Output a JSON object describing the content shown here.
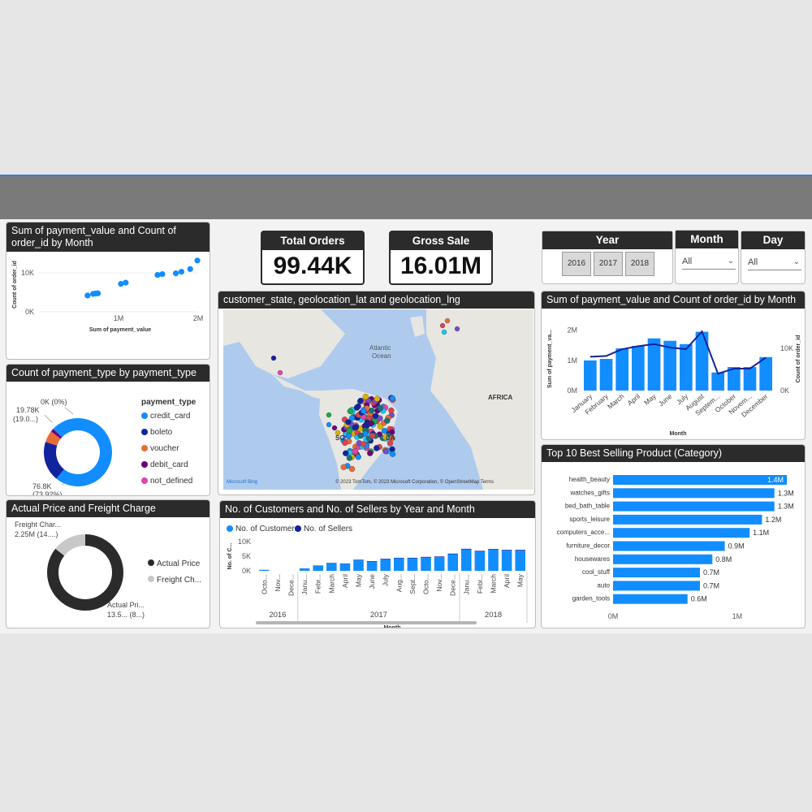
{
  "kpis": [
    {
      "label": "Total Orders",
      "value": "99.44K"
    },
    {
      "label": "Gross Sale",
      "value": "16.01M"
    }
  ],
  "slicers": {
    "year": {
      "title": "Year",
      "options": [
        "2016",
        "2017",
        "2018"
      ]
    },
    "month": {
      "title": "Month",
      "value": "All"
    },
    "day": {
      "title": "Day",
      "value": "All"
    }
  },
  "scatter": {
    "title": "Sum of payment_value and Count of order_id by Month",
    "xlabel": "Sum of payment_value",
    "ylabel": "Count of order_id",
    "xticks": [
      "1M",
      "2M"
    ],
    "yticks": [
      "0K",
      "10K"
    ]
  },
  "donut_payment": {
    "title": "Count of payment_type by payment_type",
    "legend_title": "payment_type",
    "labels": {
      "big": "76.8K",
      "big_pct": "(73.92%)",
      "mid": "19.78K",
      "mid_pct": "(19.0...)",
      "zero": "0K (0%)"
    }
  },
  "donut_price": {
    "title": "Actual Price and Freight Charge",
    "labels": {
      "freight": "Freight Char...",
      "freight_val": "2.25M (14....)",
      "actual": "Actual Pri...",
      "actual_val": "13.5... (8...)"
    }
  },
  "map": {
    "title": "customer_state, geolocation_lat and geolocation_lng",
    "labels": {
      "ocean": "Atlantic",
      "ocean2": "Ocean",
      "africa": "AFRICA",
      "so": "SO",
      "ca": "CA",
      "logo": "Microsoft Bing",
      "attribution": "© 2023 TomTom, © 2023 Microsoft Corporation, © OpenStreetMap  Terms"
    }
  },
  "combo": {
    "title": "Sum of payment_value and Count of order_id by Month",
    "xlabel": "Month",
    "ylabel_left": "Sum of payment_va...",
    "ylabel_right": "Count of order_id",
    "yticks_left": [
      "0M",
      "1M",
      "2M"
    ],
    "yticks_right": [
      "0K",
      "10K"
    ]
  },
  "customers": {
    "title": "No. of Customers and No. of Sellers by Year and Month",
    "legend": [
      "No. of Customers",
      "No. of Sellers"
    ],
    "xlabel": "Month",
    "ylabel": "No. of C...",
    "yticks": [
      "0K",
      "5K",
      "10K"
    ],
    "years": [
      "2016",
      "2017",
      "2018"
    ]
  },
  "topcat": {
    "title": "Top 10 Best Selling Product (Category)",
    "xticks": [
      "0M",
      "1M"
    ]
  },
  "chart_data": [
    {
      "type": "scatter",
      "title": "Sum of payment_value and Count of order_id by Month",
      "xlabel": "Sum of payment_value",
      "ylabel": "Count of order_id",
      "xlim": [
        0,
        2000000
      ],
      "ylim": [
        0,
        14000
      ],
      "points": [
        {
          "x": 610000,
          "y": 4200
        },
        {
          "x": 680000,
          "y": 4600
        },
        {
          "x": 710000,
          "y": 4700
        },
        {
          "x": 740000,
          "y": 4750
        },
        {
          "x": 1030000,
          "y": 7200
        },
        {
          "x": 1090000,
          "y": 7500
        },
        {
          "x": 1490000,
          "y": 9500
        },
        {
          "x": 1550000,
          "y": 9700
        },
        {
          "x": 1720000,
          "y": 9900
        },
        {
          "x": 1790000,
          "y": 10300
        },
        {
          "x": 1900000,
          "y": 11000
        },
        {
          "x": 1990000,
          "y": 13200
        }
      ]
    },
    {
      "type": "pie",
      "title": "Count of payment_type by payment_type",
      "donut": true,
      "categories": [
        "credit_card",
        "boleto",
        "voucher",
        "debit_card",
        "not_defined"
      ],
      "values": [
        76800,
        19780,
        5780,
        1530,
        3
      ],
      "colors": [
        "#118dff",
        "#12239e",
        "#e66c37",
        "#6b007b",
        "#e044a7"
      ]
    },
    {
      "type": "pie",
      "title": "Actual Price and Freight Charge",
      "donut": true,
      "categories": [
        "Actual Price",
        "Freight Charge"
      ],
      "values": [
        13500000,
        2250000
      ],
      "colors": [
        "#2b2b2b",
        "#c8c8c8"
      ]
    },
    {
      "type": "bar",
      "title": "Sum of payment_value and Count of order_id by Month",
      "categories": [
        "January",
        "February",
        "March",
        "April",
        "May",
        "June",
        "July",
        "August",
        "September",
        "October",
        "November",
        "December"
      ],
      "x_tick_labels": [
        "January",
        "February",
        "March",
        "April",
        "May",
        "June",
        "July",
        "August",
        "Septem...",
        "October",
        "Novem...",
        "December"
      ],
      "series": [
        {
          "kind": "bar",
          "values": [
            1000000,
            1050000,
            1400000,
            1480000,
            1730000,
            1650000,
            1540000,
            1950000,
            600000,
            780000,
            780000,
            1110000
          ]
        },
        {
          "kind": "line",
          "axis": "right",
          "values": [
            8000,
            8200,
            9800,
            10500,
            11000,
            10200,
            9800,
            14000,
            4000,
            5200,
            5200,
            7800
          ]
        }
      ],
      "ylim": [
        0,
        2100000
      ],
      "ylim_right": [
        0,
        15000
      ]
    },
    {
      "type": "bar",
      "title": "No. of Customers and No. of Sellers by Year and Month",
      "x_tick_labels": [
        "Octo...",
        "Nov...",
        "Dece...",
        "Janu...",
        "Febr...",
        "March",
        "April",
        "May",
        "June",
        "July",
        "Aug...",
        "Sept...",
        "Octo...",
        "Nov...",
        "Dece...",
        "Janu...",
        "Febr...",
        "March",
        "April",
        "May"
      ],
      "groups": [
        {
          "year": "2016",
          "start": 0,
          "end": 2
        },
        {
          "year": "2017",
          "start": 3,
          "end": 14
        },
        {
          "year": "2018",
          "start": 15,
          "end": 19
        }
      ],
      "series": [
        {
          "name": "No. of Customers",
          "values": [
            320,
            5,
            1,
            800,
            1750,
            2600,
            2400,
            3700,
            3200,
            4000,
            4300,
            4300,
            4600,
            4700,
            5700,
            7300,
            6600,
            7200,
            6900,
            6900
          ]
        },
        {
          "name": "No. of Sellers",
          "values": [
            140,
            1,
            1,
            230,
            390,
            470,
            500,
            560,
            540,
            590,
            620,
            660,
            690,
            830,
            800,
            950,
            960,
            1010,
            1050,
            1050
          ]
        }
      ],
      "colors": [
        "#118dff",
        "#12239e"
      ],
      "ylim": [
        0,
        10000
      ]
    },
    {
      "type": "bar",
      "orientation": "horizontal",
      "title": "Top 10 Best Selling Product (Category)",
      "categories": [
        "health_beauty",
        "watches_gifts",
        "bed_bath_table",
        "sports_leisure",
        "computers_acce...",
        "furniture_decor",
        "housewares",
        "cool_stuff",
        "auto",
        "garden_tools"
      ],
      "values": [
        1.4,
        1.3,
        1.3,
        1.2,
        1.1,
        0.9,
        0.8,
        0.7,
        0.7,
        0.6
      ],
      "labels": [
        "1.4M",
        "1.3M",
        "1.3M",
        "1.2M",
        "1.1M",
        "0.9M",
        "0.8M",
        "0.7M",
        "0.7M",
        "0.6M"
      ],
      "xlim": [
        0,
        1.4
      ]
    }
  ],
  "colors": {
    "accent": "#118dff",
    "dark": "#12239e",
    "header": "#2b2b2b"
  }
}
